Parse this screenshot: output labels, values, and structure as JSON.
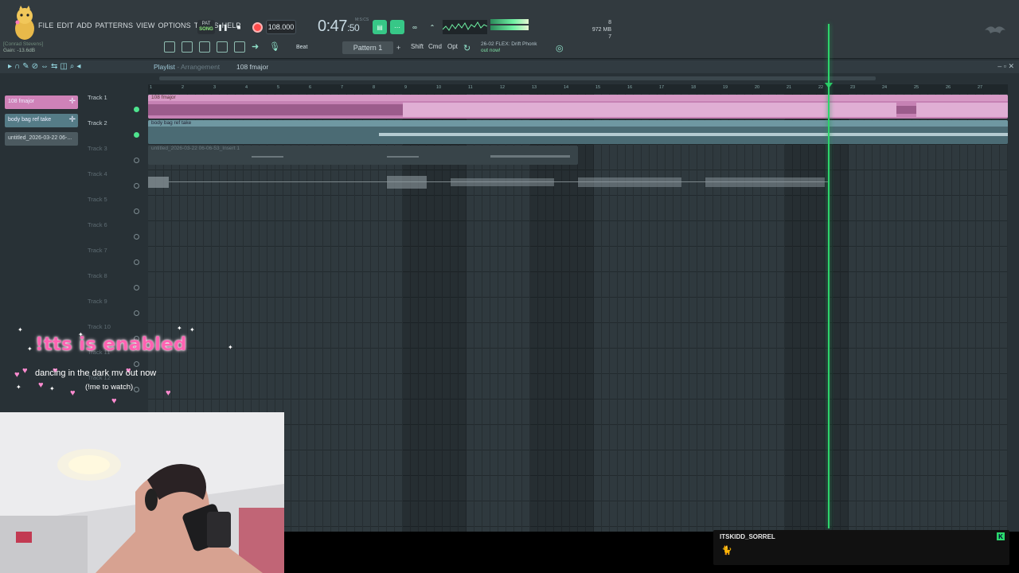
{
  "menu": [
    "FILE",
    "EDIT",
    "ADD",
    "PATTERNS",
    "VIEW",
    "OPTIONS",
    "TOOLS",
    "HELP"
  ],
  "hint_panel": {
    "title": "[Conrad Stevens]",
    "gain": "Gain: -13.6dB"
  },
  "transport": {
    "mode_top": "PAT",
    "mode_active": "SONG",
    "tempo": "108.000",
    "time_main": "0:47",
    "time_frac": ":50",
    "time_sub": "M:S:CS",
    "cpu_top": "8",
    "memory": "972 MB",
    "voices": "7"
  },
  "toolbar": {
    "snap_label": "Beat",
    "pattern": "Pattern 1",
    "plus": "+",
    "shift": "Shift",
    "cmd": "Cmd",
    "opt": "Opt",
    "news_line1": "26-02  FLEX: Drift Phonk",
    "news_line2": "out now!"
  },
  "playlist": {
    "title": "Playlist",
    "subtitle": "- Arrangement",
    "pattern": "108 fmajor",
    "picker": [
      {
        "label": "108 fmajor",
        "color": "pink"
      },
      {
        "label": "body bag ref take",
        "color": "teal"
      },
      {
        "label": "untitled_2026-03-22 06-...",
        "color": "gray"
      }
    ],
    "tracks": [
      "Track 1",
      "Track 2",
      "Track 3",
      "Track 4",
      "Track 5",
      "Track 6",
      "Track 7",
      "Track 8",
      "Track 9",
      "Track 10",
      "Track 11",
      "Track 12"
    ],
    "ruler": [
      "1",
      "2",
      "3",
      "4",
      "5",
      "6",
      "7",
      "8",
      "9",
      "10",
      "11",
      "12",
      "13",
      "14",
      "15",
      "16",
      "17",
      "18",
      "19",
      "20",
      "21",
      "22",
      "23",
      "24",
      "25",
      "26",
      "27"
    ],
    "clips": {
      "clip1": "108 fmajor",
      "clip2": "body bag ref take",
      "clip3": "untitled_2026-03-22 06-06-53_Insert 1"
    }
  },
  "overlay": {
    "tts": "!tts is enabled",
    "promo": "dancing in the dark mv out now",
    "promo2": "(!me to watch)"
  },
  "chat": {
    "user": "ITSKIDD_SORREL",
    "message": "🐈",
    "badge": "K"
  },
  "colors": {
    "accent": "#2ed46c",
    "pink_clip": "#c681b4",
    "teal_clip": "#4b6b74",
    "tts": "#ff63b2"
  }
}
